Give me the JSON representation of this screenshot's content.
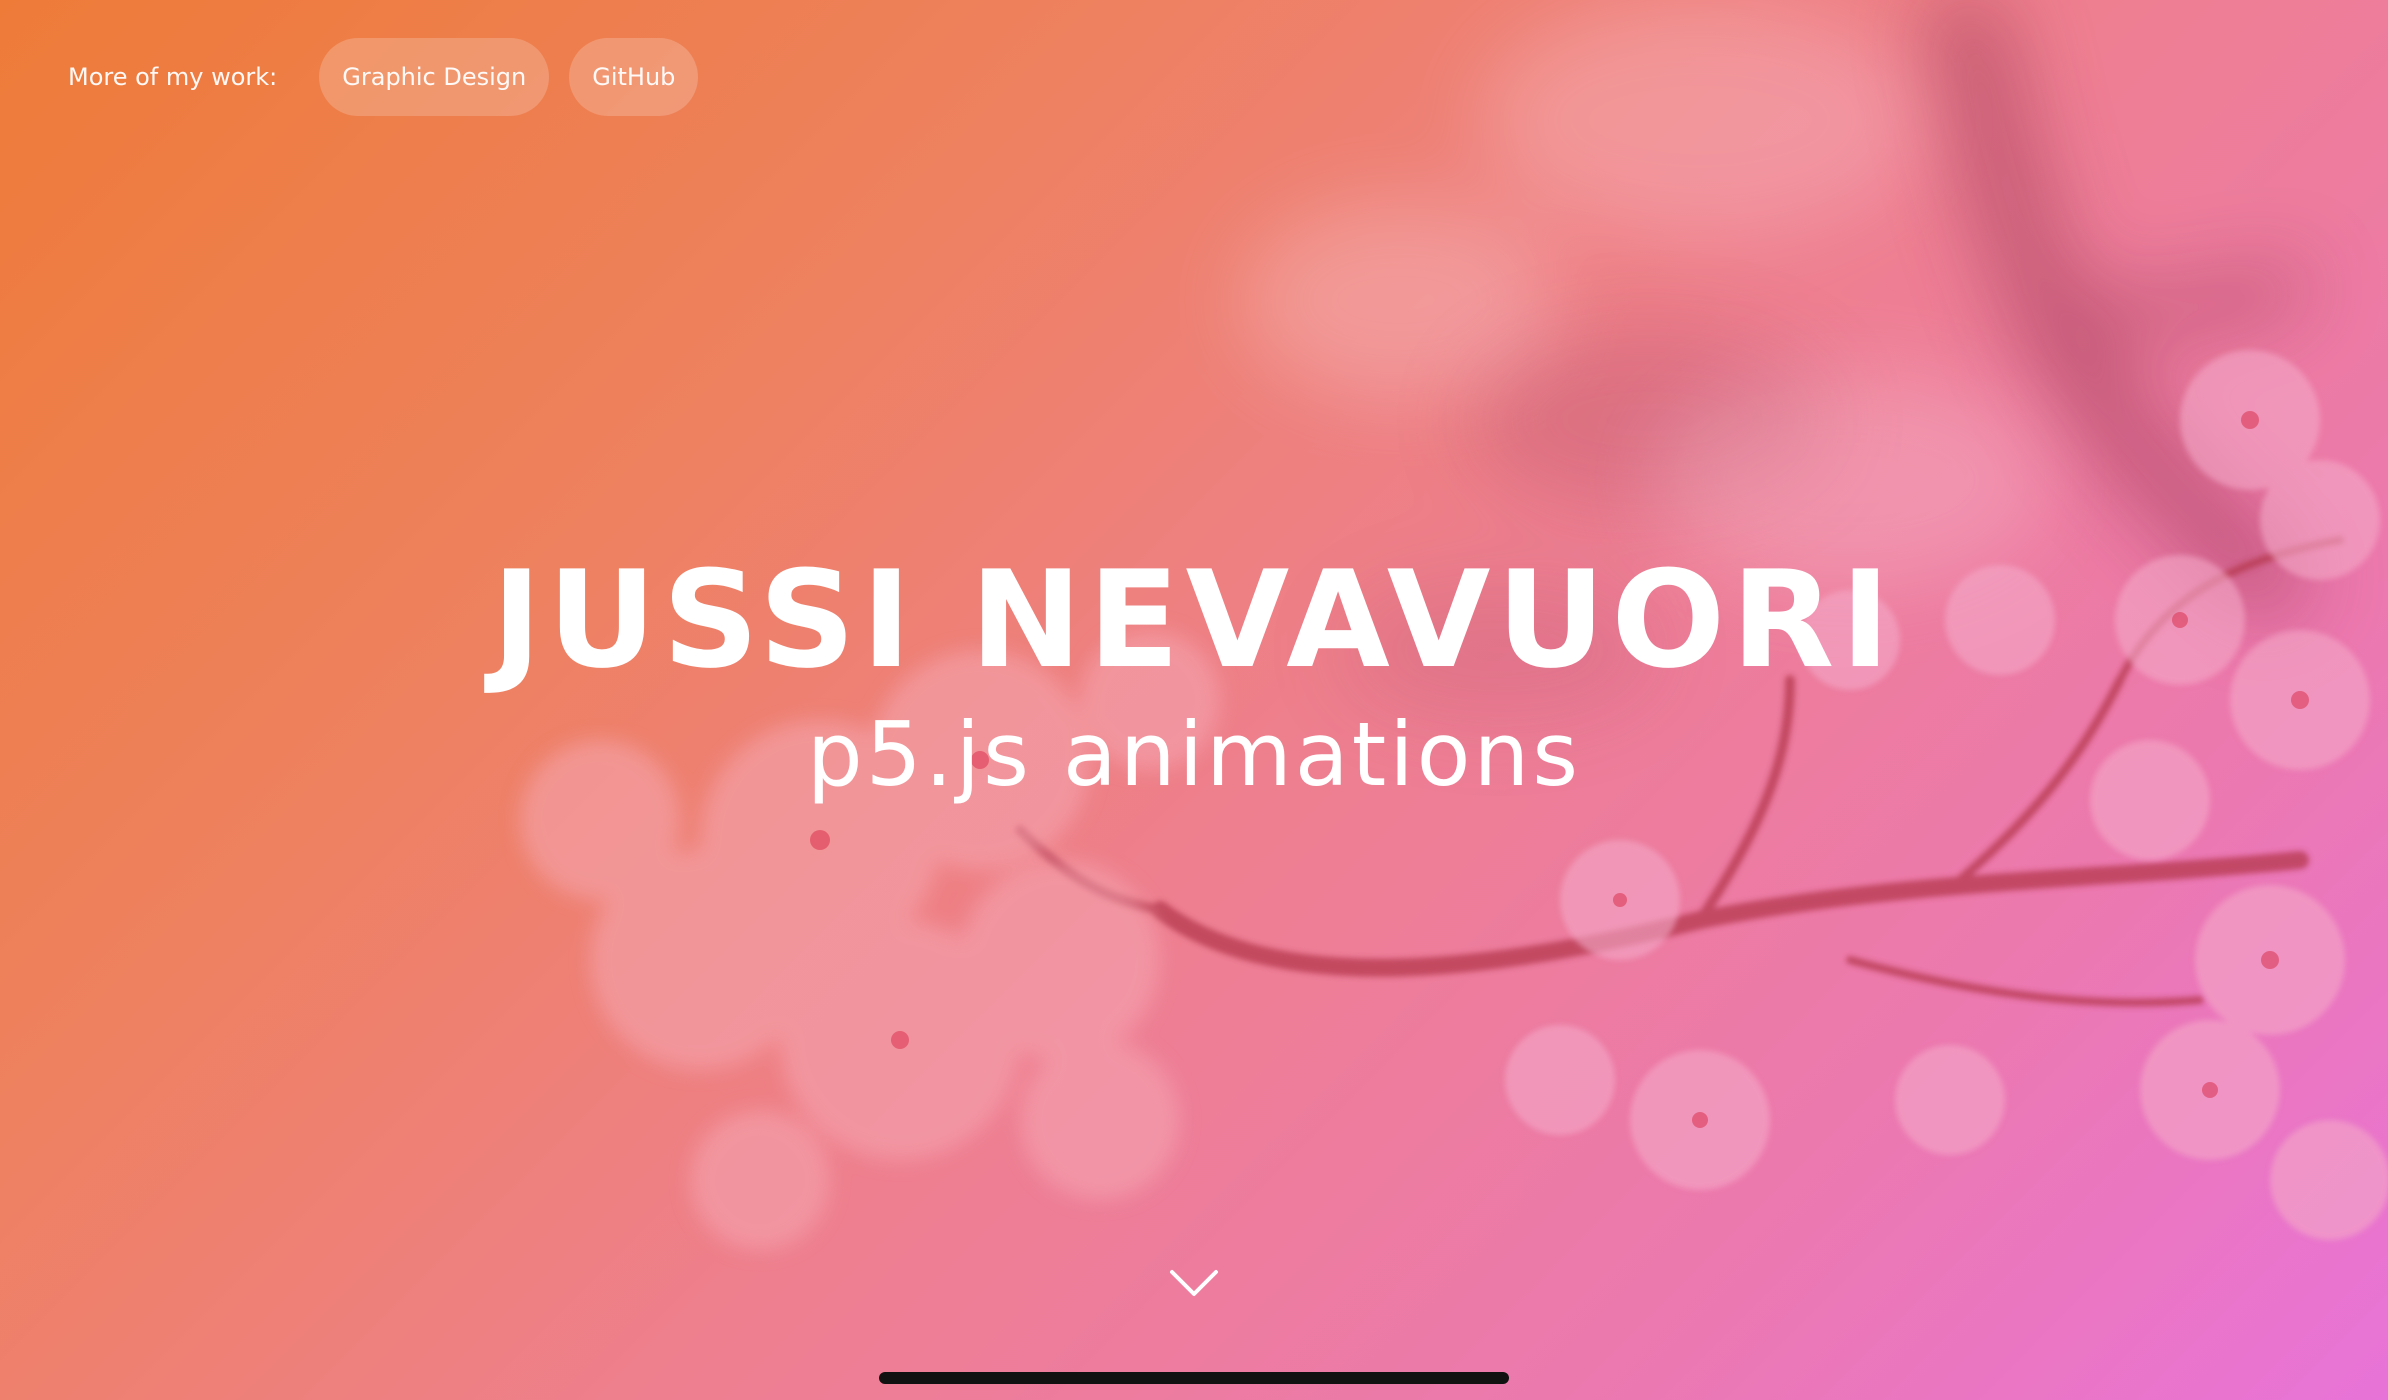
{
  "nav": {
    "label": "More of my work:",
    "links": [
      {
        "label": "Graphic Design"
      },
      {
        "label": "GitHub"
      }
    ]
  },
  "hero": {
    "title": "JUSSI NEVAVUORI",
    "subtitle": "p5.js animations"
  },
  "icons": {
    "scroll": "chevron-down-icon"
  },
  "colors": {
    "gradient_start": "#ee7b38",
    "gradient_end": "#e873d8",
    "text": "#ffffff",
    "pill_bg": "rgba(255,255,255,0.2)"
  }
}
